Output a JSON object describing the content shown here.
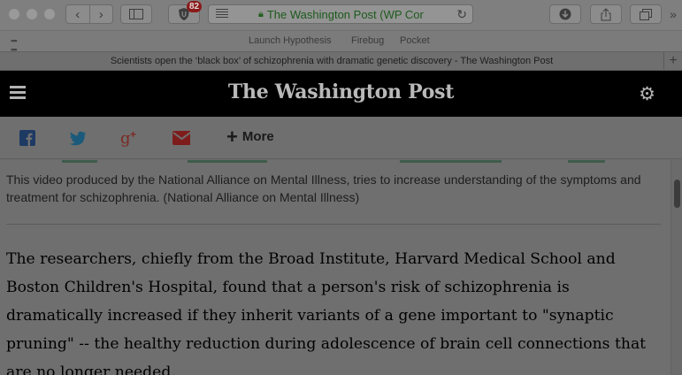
{
  "browser": {
    "ublock_badge": "82",
    "url_text": "The Washington Post (WP Cor",
    "favorites": [
      "Launch Hypothesis",
      "Firebug",
      "Pocket"
    ],
    "tab_title": "Scientists open the ‘black box’ of schizophrenia with dramatic genetic discovery - The Washington Post",
    "new_tab_symbol": "+"
  },
  "site": {
    "logo_text": "The Washington Post"
  },
  "share": {
    "more_label": "More",
    "icons": [
      "facebook-icon",
      "twitter-icon",
      "google-plus-icon",
      "email-icon"
    ],
    "colors": {
      "facebook": "#1d3a63",
      "twitter": "#1b5a7a",
      "google_plus": "#7a2a22",
      "email": "#7e1c1c"
    }
  },
  "article": {
    "caption": "This video produced by the National Alliance on Mental Illness, tries to increase understanding of the symptoms and treatment for schizophrenia. (National Alliance on Mental Illness)",
    "paragraph": "The researchers, chiefly from the Broad Institute, Harvard Medical School and Boston Children's Hospital, found that a person's risk of schizophrenia is dramatically increased if they inherit variants of a gene important to \"synaptic pruning\" -- the healthy reduction during adolescence of brain cell connections that are no longer needed."
  }
}
